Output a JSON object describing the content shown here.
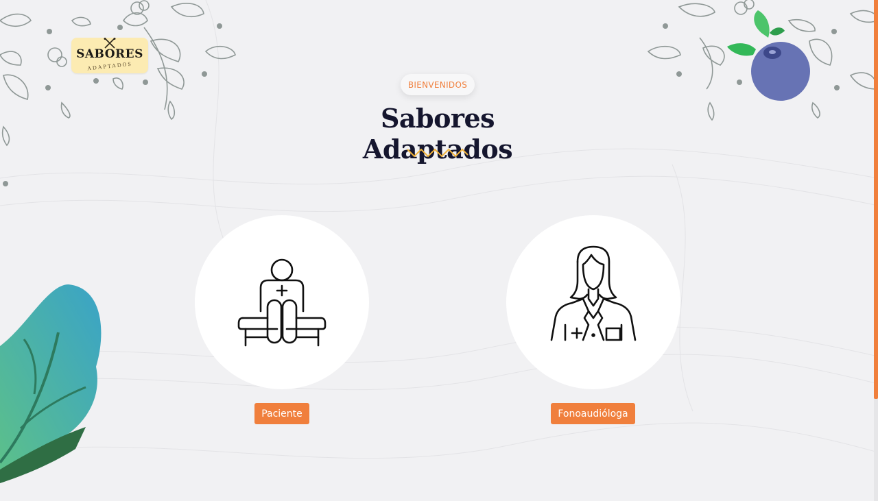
{
  "brand": {
    "logo_title": "SABORES",
    "logo_subtitle": "ADAPTADOS"
  },
  "hero": {
    "badge": "BIENVENIDOS",
    "title": "Sabores Adaptados"
  },
  "roles": [
    {
      "label": "Paciente",
      "icon": "patient-icon"
    },
    {
      "label": "Fonoaudióloga",
      "icon": "doctor-icon"
    }
  ],
  "colors": {
    "accent": "#f07f3c",
    "title": "#15162e",
    "background": "#f1f1f3",
    "logo_bg": "#fcebb2",
    "zigzag": "#f3b43a",
    "blueberry": "#5f6cb0",
    "leaf": "#3fae8c"
  }
}
